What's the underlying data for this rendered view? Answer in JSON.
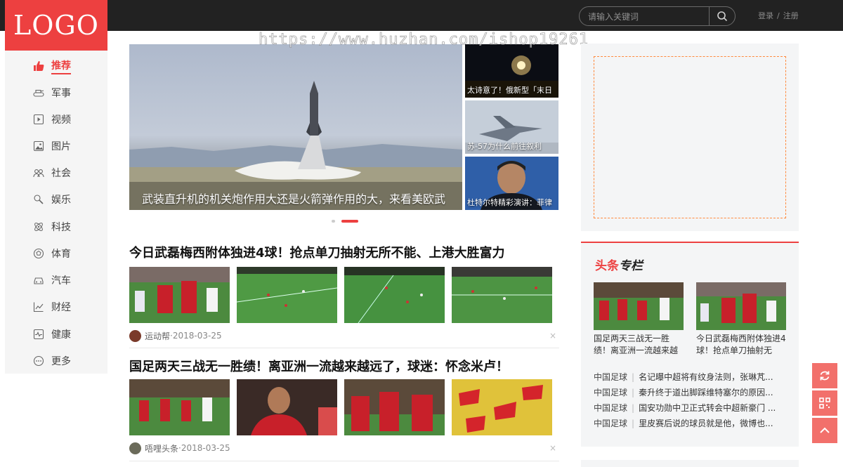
{
  "header": {
    "logo": "LOGO",
    "search_placeholder": "请输入关键词",
    "login": "登录",
    "sep": "/",
    "register": "注册"
  },
  "watermark": "https://www.huzhan.com/ishop19261",
  "sidebar": {
    "items": [
      {
        "label": "推荐",
        "icon": "thumbs-up-icon",
        "active": true
      },
      {
        "label": "军事",
        "icon": "tank-icon"
      },
      {
        "label": "视频",
        "icon": "play-icon"
      },
      {
        "label": "图片",
        "icon": "image-icon"
      },
      {
        "label": "社会",
        "icon": "people-icon"
      },
      {
        "label": "娱乐",
        "icon": "microphone-icon"
      },
      {
        "label": "科技",
        "icon": "atom-icon"
      },
      {
        "label": "体育",
        "icon": "ball-icon"
      },
      {
        "label": "汽车",
        "icon": "car-icon"
      },
      {
        "label": "财经",
        "icon": "chart-icon"
      },
      {
        "label": "健康",
        "icon": "heartbeat-icon"
      },
      {
        "label": "更多",
        "icon": "more-icon"
      }
    ]
  },
  "slider": {
    "caption": "武装直升机的机关炮作用大还是火箭弹作用的大，来看美欧武",
    "thumbs": [
      {
        "caption": "太诗意了！俄新型「末日"
      },
      {
        "caption": "苏-57为什么前往叙利"
      },
      {
        "caption": "杜特尔特精彩演讲：菲律"
      }
    ]
  },
  "articles": [
    {
      "title": "今日武磊梅西附体独进4球！抢点单刀抽射无所不能、上港大胜富力",
      "source": "运动帮",
      "dot": " · ",
      "date": "2018-03-25",
      "close": "×"
    },
    {
      "title": "国足两天三战无一胜绩！离亚洲一流越来越远了，球迷：怀念米卢！",
      "source": "唔哩头条",
      "dot": " · ",
      "date": "2018-03-25",
      "close": "×"
    }
  ],
  "special": {
    "heading_a": "头条",
    "heading_b": "专栏",
    "cards": [
      {
        "text": "国足两天三战无一胜绩！离亚洲一流越来越"
      },
      {
        "text": "今日武磊梅西附体独进4球！抢点单刀抽射无"
      }
    ],
    "list": [
      {
        "cat": "中国足球",
        "bar": "|",
        "text": "名记曝中超将有纹身法则，张琳芃..."
      },
      {
        "cat": "中国足球",
        "bar": "|",
        "text": "秦升终于道出脚踩维特塞尔的原因..."
      },
      {
        "cat": "中国足球",
        "bar": "|",
        "text": "国安功勋中卫正式转会中超新豪门 ..."
      },
      {
        "cat": "中国足球",
        "bar": "|",
        "text": "里皮赛后说的球员就是他，微博也..."
      }
    ]
  },
  "colors": {
    "brand": "#ed4040",
    "topbar": "#222222",
    "float": "#f2706b"
  }
}
